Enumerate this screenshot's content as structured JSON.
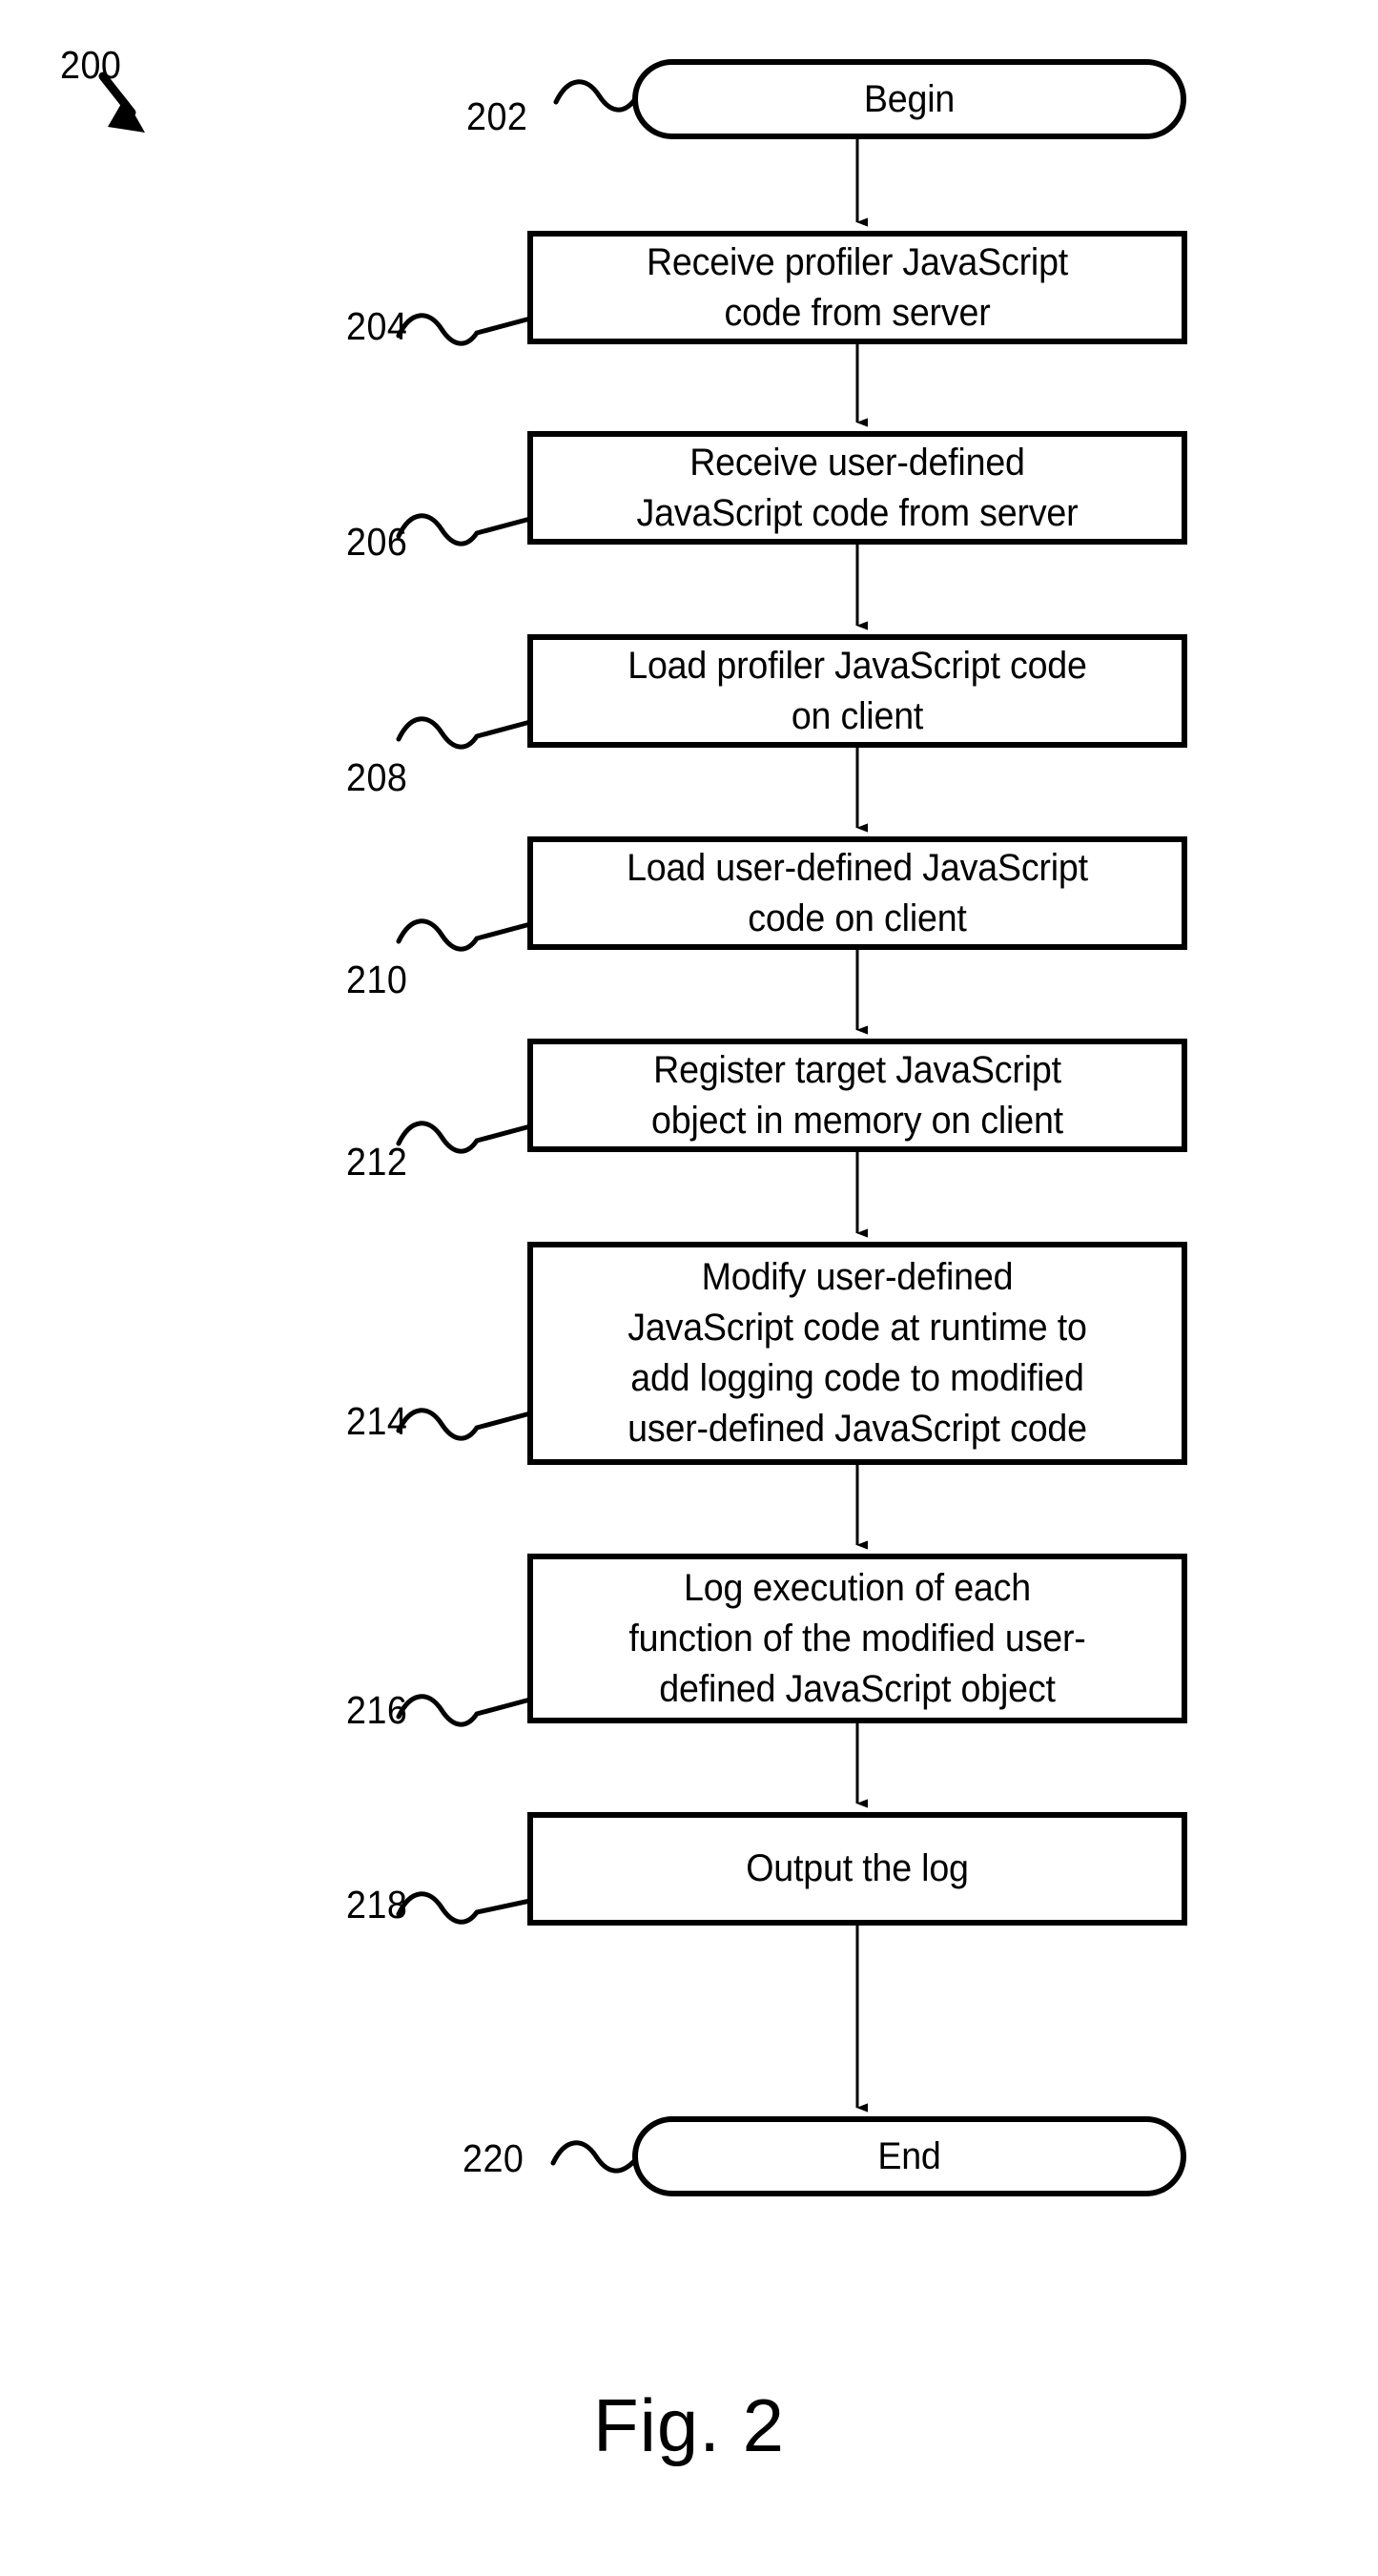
{
  "figure": {
    "caption": "Fig. 2",
    "diagram_number": "200"
  },
  "nodes": [
    {
      "ref": "202",
      "shape": "terminal",
      "text": "Begin"
    },
    {
      "ref": "204",
      "shape": "process",
      "text": "Receive profiler JavaScript\ncode from server"
    },
    {
      "ref": "206",
      "shape": "process",
      "text": "Receive user-defined\nJavaScript code from server"
    },
    {
      "ref": "208",
      "shape": "process",
      "text": "Load profiler JavaScript code\non client"
    },
    {
      "ref": "210",
      "shape": "process",
      "text": "Load user-defined JavaScript\ncode on client"
    },
    {
      "ref": "212",
      "shape": "process",
      "text": "Register target JavaScript\nobject in memory on client"
    },
    {
      "ref": "214",
      "shape": "process",
      "text": "Modify user-defined\nJavaScript code at runtime to\nadd logging code to modified\nuser-defined JavaScript code"
    },
    {
      "ref": "216",
      "shape": "process",
      "text": "Log execution of each\nfunction of the modified user-\ndefined JavaScript object"
    },
    {
      "ref": "218",
      "shape": "process",
      "text": "Output the log"
    },
    {
      "ref": "220",
      "shape": "terminal",
      "text": "End"
    }
  ],
  "colors": {
    "stroke": "#000000",
    "fill": "#ffffff"
  }
}
